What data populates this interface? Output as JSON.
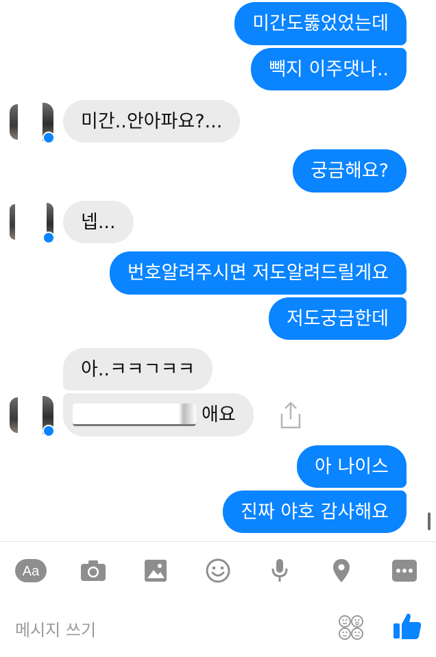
{
  "messages": [
    {
      "text": "미간도뚫었었는데",
      "direction": "outgoing"
    },
    {
      "text": "빽지 이주댓나..",
      "direction": "outgoing"
    },
    {
      "text": "미간..안아파요?...",
      "direction": "incoming"
    },
    {
      "text": "궁금해요?",
      "direction": "outgoing"
    },
    {
      "text": "넵...",
      "direction": "incoming"
    },
    {
      "text": "번호알려주시면 저도알려드릴게요",
      "direction": "outgoing"
    },
    {
      "text": "저도궁금한데",
      "direction": "outgoing"
    },
    {
      "text": "아..ㅋㅋㄱㅋㅋ",
      "direction": "incoming"
    },
    {
      "text": "애요",
      "direction": "incoming",
      "partially_redacted": true
    },
    {
      "text": "아 나이스",
      "direction": "outgoing"
    },
    {
      "text": "진짜 야호 감사해요",
      "direction": "outgoing"
    }
  ],
  "toolbar": {
    "text_icon_label": "Aa",
    "icons": [
      "text-format-icon",
      "camera-icon",
      "image-icon",
      "emoji-icon",
      "microphone-icon",
      "location-icon",
      "more-icon"
    ]
  },
  "composer": {
    "placeholder": "메시지 쓰기"
  },
  "colors": {
    "outgoing_bubble": "#0a84ff",
    "incoming_bubble": "#ebebeb",
    "icon_gray": "#8e8e8e",
    "accent": "#0a84ff"
  }
}
